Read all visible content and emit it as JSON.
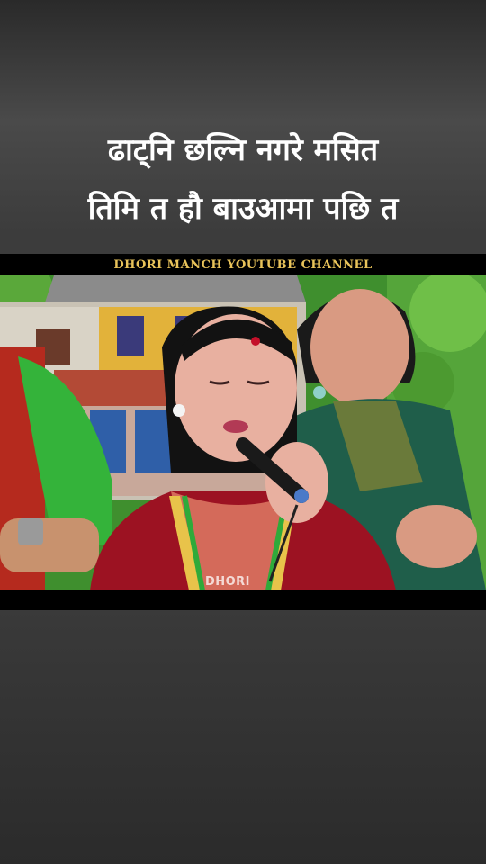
{
  "caption": {
    "line1": "ढाट्नि छल्नि नगरे मसित",
    "line2": "तिमि त हौ बाउआमा पछि त"
  },
  "video": {
    "channel_banner": "DHORI MANCH YOUTUBE CHANNEL",
    "watermark": "DHORI MANCH",
    "scene_description_icon": "music-performance-photo"
  },
  "colors": {
    "background": "#3a3a3a",
    "caption_text": "#ffffff",
    "banner_text": "#e9c35a",
    "dress_red": "#9c1222",
    "sari_green": "#1f5e4a"
  }
}
